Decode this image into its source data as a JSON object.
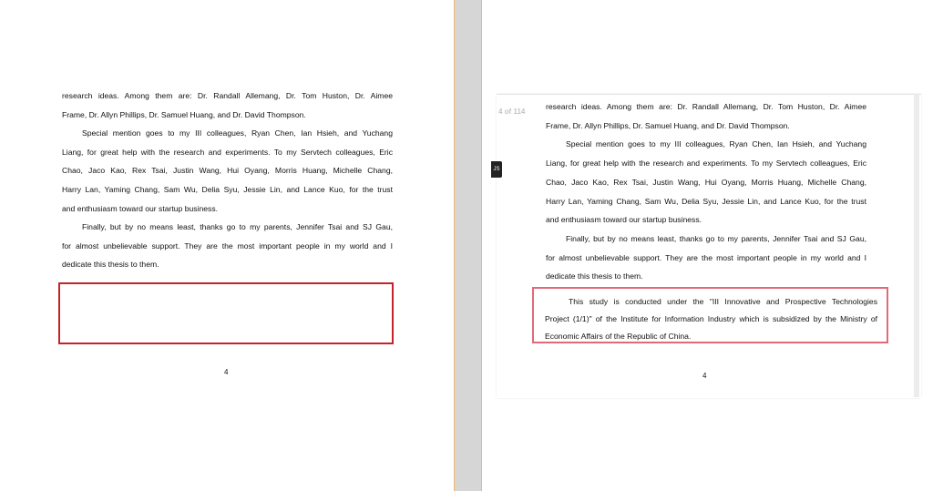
{
  "left_page": {
    "paragraphs": [
      {
        "indent": false,
        "lines": [
          "research ideas. Among them are: Dr. Randall Allemang, Dr. Tom Huston, Dr. Aimee",
          "Frame, Dr. Allyn Phillips, Dr. Samuel Huang, and Dr. David Thompson."
        ]
      },
      {
        "indent": true,
        "lines": [
          "Special mention goes to my III colleagues, Ryan Chen, Ian Hsieh, and Yuchang",
          "Liang, for great help with the research and experiments.  To my Servtech colleagues, Eric",
          "Chao, Jaco Kao, Rex Tsai, Justin Wang, Hui Oyang, Morris Huang, Michelle Chang,",
          "Harry Lan, Yaming Chang, Sam Wu, Delia Syu, Jessie Lin, and Lance Kuo, for the trust",
          "and enthusiasm toward our startup business."
        ]
      },
      {
        "indent": true,
        "lines": [
          "Finally, but by no means least, thanks go to my parents, Jennifer Tsai and SJ Gau,",
          "for almost unbelievable support.  They are the most important people in my world and I",
          "dedicate this thesis to them."
        ]
      }
    ],
    "page_number": "4"
  },
  "right_page": {
    "page_counter": "4 of 114",
    "side_tab_label": "JS",
    "paragraphs": [
      {
        "indent": false,
        "lines": [
          "research ideas. Among them are: Dr. Randall Allemang, Dr. Tom Huston, Dr. Aimee",
          "Frame, Dr. Allyn Phillips, Dr. Samuel Huang, and Dr. David Thompson."
        ]
      },
      {
        "indent": true,
        "lines": [
          "Special mention goes to my III colleagues, Ryan Chen, Ian Hsieh, and Yuchang",
          "Liang, for great help with the research and experiments.  To my Servtech colleagues, Eric",
          "Chao, Jaco Kao, Rex Tsai, Justin Wang, Hui Oyang, Morris Huang, Michelle Chang,",
          "Harry Lan, Yaming Chang, Sam Wu, Delia Syu, Jessie Lin, and Lance Kuo, for the trust",
          "and enthusiasm toward our startup business."
        ]
      },
      {
        "indent": true,
        "lines": [
          "Finally, but by no means least, thanks go to my parents, Jennifer Tsai and SJ Gau,",
          "for almost unbelievable support.  They are the most important people in my world and I",
          "dedicate this thesis to them."
        ]
      }
    ],
    "funding_note_lines": [
      "This study is conducted under the \"III Innovative and Prospective Technologies",
      "Project (1/1)\" of the Institute for Information Industry which is subsidized by the Ministry of",
      "Economic Affairs of the Republic of China."
    ],
    "page_number": "4"
  },
  "colors": {
    "highlight_left": "#c4232b",
    "highlight_right": "#e06a78",
    "page_edge": "#f0b86c",
    "gutter": "#d6d6d6"
  }
}
